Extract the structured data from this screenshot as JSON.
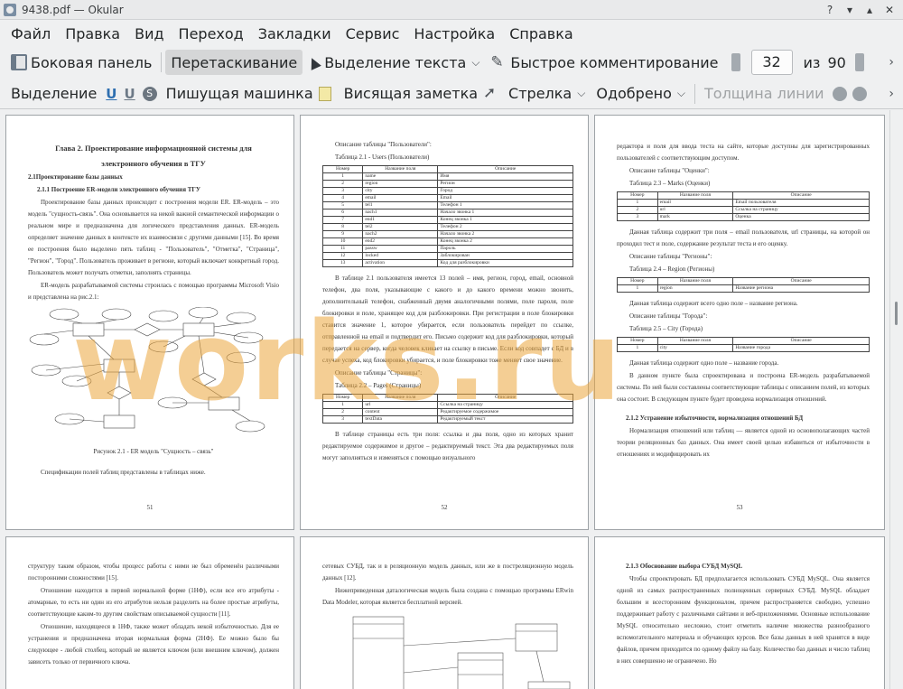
{
  "window": {
    "title": "9438.pdf — Okular"
  },
  "menu": [
    "Файл",
    "Правка",
    "Вид",
    "Переход",
    "Закладки",
    "Сервис",
    "Настройка",
    "Справка"
  ],
  "toolbar1": {
    "sidebar": "Боковая панель",
    "drag": "Перетаскивание",
    "select_text": "Выделение текста",
    "quick_comment": "Быстрое комментирование",
    "page_current": "32",
    "page_of": "из",
    "page_total": "90"
  },
  "toolbar2": {
    "highlight": "Выделение",
    "typewriter": "Пишущая машинка",
    "sticky_note": "Висящая заметка",
    "arrow": "Стрелка",
    "approved": "Одобрено",
    "line_width": "Толщина линии"
  },
  "watermark": "works.ru",
  "pages": {
    "p51": {
      "title1": "Глава 2. Проектирование информационной системы для",
      "title2": "электронного обучения в ТГУ",
      "section": "2.1Проектирование базы данных",
      "subsection": "2.1.1  Построение ER-модели электронного обучения ТГУ",
      "para1": "Проектирование базы данных происходит с построения модели ER. ER-модель – это модель \"сущность-связь\". Она основывается на некой важной семантической информации о реальном мире и предназначена для логического представления данных. ER-модель определяет значение данных в контексте их взаимосвязи с другими данными [15]. Во время ее построения было выделено пять таблиц - \"Пользователь\", \"Отметка\", \"Страница\", \"Регион\", \"Город\". Пользователь проживает в регионе, который включает конкретный город. Пользователь может получать отметки, заполнять страницы.",
      "para2": "ER-модель разрабатываемой системы строилась с помощью программы Microsoft Visio и представлена на рис.2.1:",
      "caption": "Рисунок 2.1 - ER модель \"Сущность – связь\"",
      "para3": "Спецификации полей таблиц представлены в таблицах ниже.",
      "num": "51"
    },
    "p52": {
      "desc1": "Описание таблицы \"Пользователи\":",
      "tcap1": "Таблица 2.1 - Users (Пользователи)",
      "thead": [
        "Номер",
        "Название поля",
        "Описание"
      ],
      "rows1": [
        [
          "1",
          "name",
          "Имя"
        ],
        [
          "2",
          "region",
          "Регион"
        ],
        [
          "3",
          "city",
          "Город"
        ],
        [
          "4",
          "email",
          "Email"
        ],
        [
          "5",
          "tel1",
          "Телефон 1"
        ],
        [
          "6",
          "nach1",
          "Начало звонка 1"
        ],
        [
          "7",
          "end1",
          "Конец звонка 1"
        ],
        [
          "8",
          "tel2",
          "Телефон 2"
        ],
        [
          "9",
          "nach2",
          "Начало звонка 2"
        ],
        [
          "10",
          "end2",
          "Конец звонка 2"
        ],
        [
          "11",
          "passw",
          "Пароль"
        ],
        [
          "12",
          "locked",
          "Заблокирован"
        ],
        [
          "13",
          "activation",
          "Код для разблокировки"
        ]
      ],
      "para1": "В таблице 2.1 пользователя имеется 13 полей – имя, регион, город, email, основной телефон, два поля, указывающие с какого и до какого времени можно звонить, дополнительный телефон, снабженный двумя аналогичными полями, поле пароля, поле блокировки и поле, хранящее код для разблокировки. При регистрации в поле блокировки ставится значение 1, которое убирается, если пользователь перейдет по ссылке, отправленной на email и подтвердит его. Письмо содержит код для разблокировки, который передается на сервер, когда человек кликает на ссылку в письме. Если код совпадет с БД и в случае успеха, код блокировки убирается, и поле блокировки тоже меняет свое значение.",
      "desc2": "Описание таблицы \"Страницы\":",
      "tcap2": "Таблица 2.2 – Pages (Страницы)",
      "rows2": [
        [
          "1",
          "url",
          "Ссылка на страницу"
        ],
        [
          "2",
          "content",
          "Редактируемое содержимое"
        ],
        [
          "3",
          "textData",
          "Редактируемый текст"
        ]
      ],
      "para2": "В таблице страницы есть три поля: ссылка и два поля, одно из которых хранит редактируемое содержимое и другое – редактируемый текст. Эта два редактируемых поля могут заполняться и изменяться с помощью визуального",
      "num": "52"
    },
    "p53": {
      "para0": "редактора и поля для ввода теста на сайте, которые доступны для зарегистрированных пользователей с соответствующим доступом.",
      "desc1": "Описание таблицы \"Оценки\":",
      "tcap1": "Таблица 2.3 – Marks (Оценки)",
      "rows1": [
        [
          "1",
          "email",
          "Email пользователя"
        ],
        [
          "2",
          "url",
          "Ссылка на страницу"
        ],
        [
          "3",
          "mark",
          "Оценка"
        ]
      ],
      "para1": "Данная таблица содержит три поля – email пользователя, url страницы, на которой он проходил тест и поле, содержание результат теста и его оценку.",
      "desc2": "Описание таблицы \"Регионы\":",
      "tcap2": "Таблица 2.4 – Region (Регионы)",
      "rows2": [
        [
          "1",
          "region",
          "Название региона"
        ]
      ],
      "para2": "Данная таблица содержит всего одно поле – название региона.",
      "desc3": "Описание таблицы \"Города\":",
      "tcap3": "Таблица 2.5 – City (Города)",
      "rows3": [
        [
          "1",
          "city",
          "Название города"
        ]
      ],
      "para3": "Данная таблица содержит одно поле – название города.",
      "para4": "В данном пункте была спроектирована и построена ER-модель разрабатываемой системы. По ней были составлены соответствующие таблицы с описанием полей, из которых она состоит. В следующем пункте будет проведена нормализация отношений.",
      "sub": "2.1.2  Устранение избыточности, нормализация отношений БД",
      "para5": "Нормализация отношений или таблиц — является одной из основополагающих частей теории реляционных баз данных. Она имеет своей целью избавиться от избыточности в отношениях и модифицировать их",
      "num": "53"
    },
    "p54": {
      "para0": "структуру таким образом, чтобы процесс работы с ними не был обременён различными посторонними сложностями [15].",
      "para1": "Отношение находится в первой нормальной форме (1НФ), если все его атрибуты - атомарные, то есть ни один из его атрибутов нельзя разделить на более простые атрибуты, соответствующие каким-то другим свойствам описываемой сущности [11].",
      "para2": "Отношение, находящееся в 1НФ, также может обладать некой избыточностью. Для ее устранения и предназначена вторая нормальная форма (2НФ). Ее можно было бы следующее - любой столбец, который не является ключом (или внешним ключом), должен зависеть только от первичного ключа."
    },
    "p55": {
      "para0": "сетевых СУБД, так и в реляционную модель данных, или же в постреляционную модель данных [12].",
      "para1": "Нижеприведенная даталогическая модель была создана с помощью программы ERwin Data Modeler, которая является бесплатной версией."
    },
    "p56": {
      "sub": "2.1.3  Обоснование выбора СУБД MySQL",
      "para1": "Чтобы спроектировать БД предполагается использовать СУБД MySQL. Она является одной из самых распространенных полноценных серверных СУБД. MySQL обладает большим и всесторонним функционалом, причем распространяется свободно, успешно поддерживает работу с различными сайтами и веб-приложениями. Основные использование MySQL относительно несложно, стоит отметить наличие множества разнообразного вспомогательного материала и обучающих курсов. Все базы данных в ней хранятся в виде файлов, причем приходится по одному файлу на базу. Количество баз данных и число таблиц в них совершенно не ограничено. Но"
    }
  }
}
